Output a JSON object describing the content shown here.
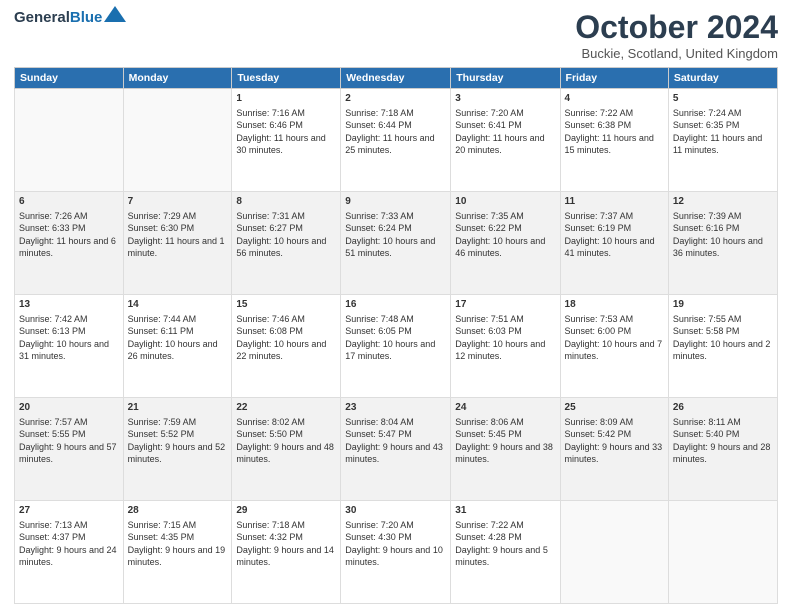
{
  "header": {
    "logo_line1": "General",
    "logo_line2": "Blue",
    "month": "October 2024",
    "location": "Buckie, Scotland, United Kingdom"
  },
  "weekdays": [
    "Sunday",
    "Monday",
    "Tuesday",
    "Wednesday",
    "Thursday",
    "Friday",
    "Saturday"
  ],
  "weeks": [
    [
      {
        "day": "",
        "info": ""
      },
      {
        "day": "",
        "info": ""
      },
      {
        "day": "1",
        "sunrise": "7:16 AM",
        "sunset": "6:46 PM",
        "daylight": "11 hours and 30 minutes."
      },
      {
        "day": "2",
        "sunrise": "7:18 AM",
        "sunset": "6:44 PM",
        "daylight": "11 hours and 25 minutes."
      },
      {
        "day": "3",
        "sunrise": "7:20 AM",
        "sunset": "6:41 PM",
        "daylight": "11 hours and 20 minutes."
      },
      {
        "day": "4",
        "sunrise": "7:22 AM",
        "sunset": "6:38 PM",
        "daylight": "11 hours and 15 minutes."
      },
      {
        "day": "5",
        "sunrise": "7:24 AM",
        "sunset": "6:35 PM",
        "daylight": "11 hours and 11 minutes."
      }
    ],
    [
      {
        "day": "6",
        "sunrise": "7:26 AM",
        "sunset": "6:33 PM",
        "daylight": "11 hours and 6 minutes."
      },
      {
        "day": "7",
        "sunrise": "7:29 AM",
        "sunset": "6:30 PM",
        "daylight": "11 hours and 1 minute."
      },
      {
        "day": "8",
        "sunrise": "7:31 AM",
        "sunset": "6:27 PM",
        "daylight": "10 hours and 56 minutes."
      },
      {
        "day": "9",
        "sunrise": "7:33 AM",
        "sunset": "6:24 PM",
        "daylight": "10 hours and 51 minutes."
      },
      {
        "day": "10",
        "sunrise": "7:35 AM",
        "sunset": "6:22 PM",
        "daylight": "10 hours and 46 minutes."
      },
      {
        "day": "11",
        "sunrise": "7:37 AM",
        "sunset": "6:19 PM",
        "daylight": "10 hours and 41 minutes."
      },
      {
        "day": "12",
        "sunrise": "7:39 AM",
        "sunset": "6:16 PM",
        "daylight": "10 hours and 36 minutes."
      }
    ],
    [
      {
        "day": "13",
        "sunrise": "7:42 AM",
        "sunset": "6:13 PM",
        "daylight": "10 hours and 31 minutes."
      },
      {
        "day": "14",
        "sunrise": "7:44 AM",
        "sunset": "6:11 PM",
        "daylight": "10 hours and 26 minutes."
      },
      {
        "day": "15",
        "sunrise": "7:46 AM",
        "sunset": "6:08 PM",
        "daylight": "10 hours and 22 minutes."
      },
      {
        "day": "16",
        "sunrise": "7:48 AM",
        "sunset": "6:05 PM",
        "daylight": "10 hours and 17 minutes."
      },
      {
        "day": "17",
        "sunrise": "7:51 AM",
        "sunset": "6:03 PM",
        "daylight": "10 hours and 12 minutes."
      },
      {
        "day": "18",
        "sunrise": "7:53 AM",
        "sunset": "6:00 PM",
        "daylight": "10 hours and 7 minutes."
      },
      {
        "day": "19",
        "sunrise": "7:55 AM",
        "sunset": "5:58 PM",
        "daylight": "10 hours and 2 minutes."
      }
    ],
    [
      {
        "day": "20",
        "sunrise": "7:57 AM",
        "sunset": "5:55 PM",
        "daylight": "9 hours and 57 minutes."
      },
      {
        "day": "21",
        "sunrise": "7:59 AM",
        "sunset": "5:52 PM",
        "daylight": "9 hours and 52 minutes."
      },
      {
        "day": "22",
        "sunrise": "8:02 AM",
        "sunset": "5:50 PM",
        "daylight": "9 hours and 48 minutes."
      },
      {
        "day": "23",
        "sunrise": "8:04 AM",
        "sunset": "5:47 PM",
        "daylight": "9 hours and 43 minutes."
      },
      {
        "day": "24",
        "sunrise": "8:06 AM",
        "sunset": "5:45 PM",
        "daylight": "9 hours and 38 minutes."
      },
      {
        "day": "25",
        "sunrise": "8:09 AM",
        "sunset": "5:42 PM",
        "daylight": "9 hours and 33 minutes."
      },
      {
        "day": "26",
        "sunrise": "8:11 AM",
        "sunset": "5:40 PM",
        "daylight": "9 hours and 28 minutes."
      }
    ],
    [
      {
        "day": "27",
        "sunrise": "7:13 AM",
        "sunset": "4:37 PM",
        "daylight": "9 hours and 24 minutes."
      },
      {
        "day": "28",
        "sunrise": "7:15 AM",
        "sunset": "4:35 PM",
        "daylight": "9 hours and 19 minutes."
      },
      {
        "day": "29",
        "sunrise": "7:18 AM",
        "sunset": "4:32 PM",
        "daylight": "9 hours and 14 minutes."
      },
      {
        "day": "30",
        "sunrise": "7:20 AM",
        "sunset": "4:30 PM",
        "daylight": "9 hours and 10 minutes."
      },
      {
        "day": "31",
        "sunrise": "7:22 AM",
        "sunset": "4:28 PM",
        "daylight": "9 hours and 5 minutes."
      },
      {
        "day": "",
        "info": ""
      },
      {
        "day": "",
        "info": ""
      }
    ]
  ]
}
